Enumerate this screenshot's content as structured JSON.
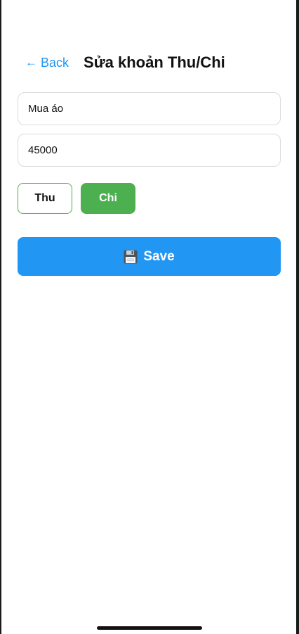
{
  "header": {
    "back_label": "Back",
    "back_icon": "left-arrow-icon",
    "title": "Sửa khoản Thu/Chi"
  },
  "form": {
    "name_value": "Mua áo",
    "amount_value": "45000",
    "type_options": [
      "Thu",
      "Chi"
    ],
    "selected_type": "Chi",
    "save_label": "Save",
    "save_icon": "floppy-disk-icon"
  },
  "colors": {
    "accent_blue": "#2196f3",
    "accent_green": "#4caf50",
    "background": "#ffffff",
    "text": "#111111",
    "border": "#dcdcdc"
  }
}
